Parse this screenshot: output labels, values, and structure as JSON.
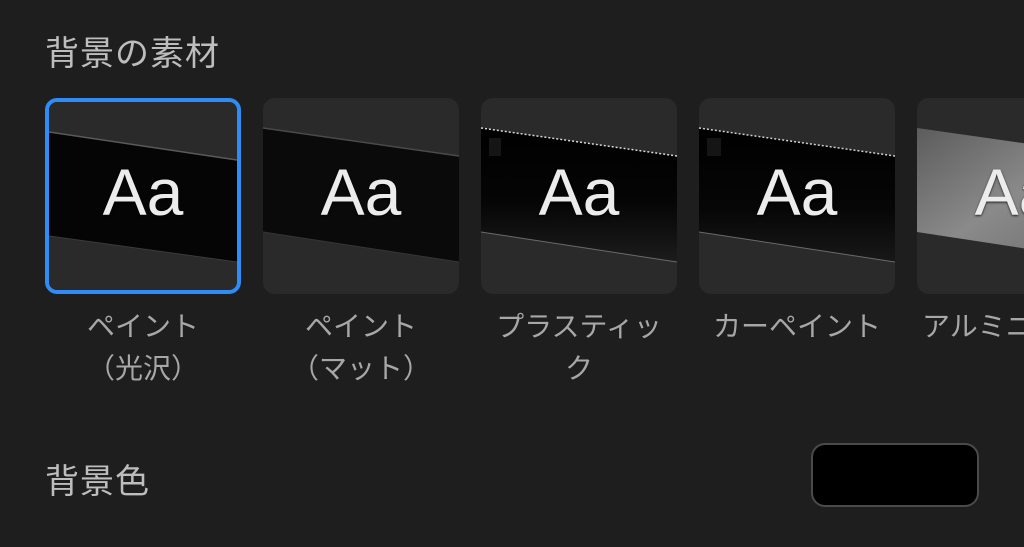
{
  "section": {
    "title": "背景の素材"
  },
  "sample_text": "Aa",
  "materials": [
    {
      "label": "ペイント\n（光沢）",
      "selected": true
    },
    {
      "label": "ペイント\n（マット）",
      "selected": false
    },
    {
      "label": "プラスティッ\nク",
      "selected": false
    },
    {
      "label": "カーペイント",
      "selected": false
    },
    {
      "label": "アルミニ",
      "selected": false
    }
  ],
  "background_color": {
    "label": "背景色",
    "value": "#000000"
  },
  "colors": {
    "page_background": "#1e1e1e",
    "selection_accent": "#2f8cf6",
    "label_text": "#a7a7a7"
  }
}
